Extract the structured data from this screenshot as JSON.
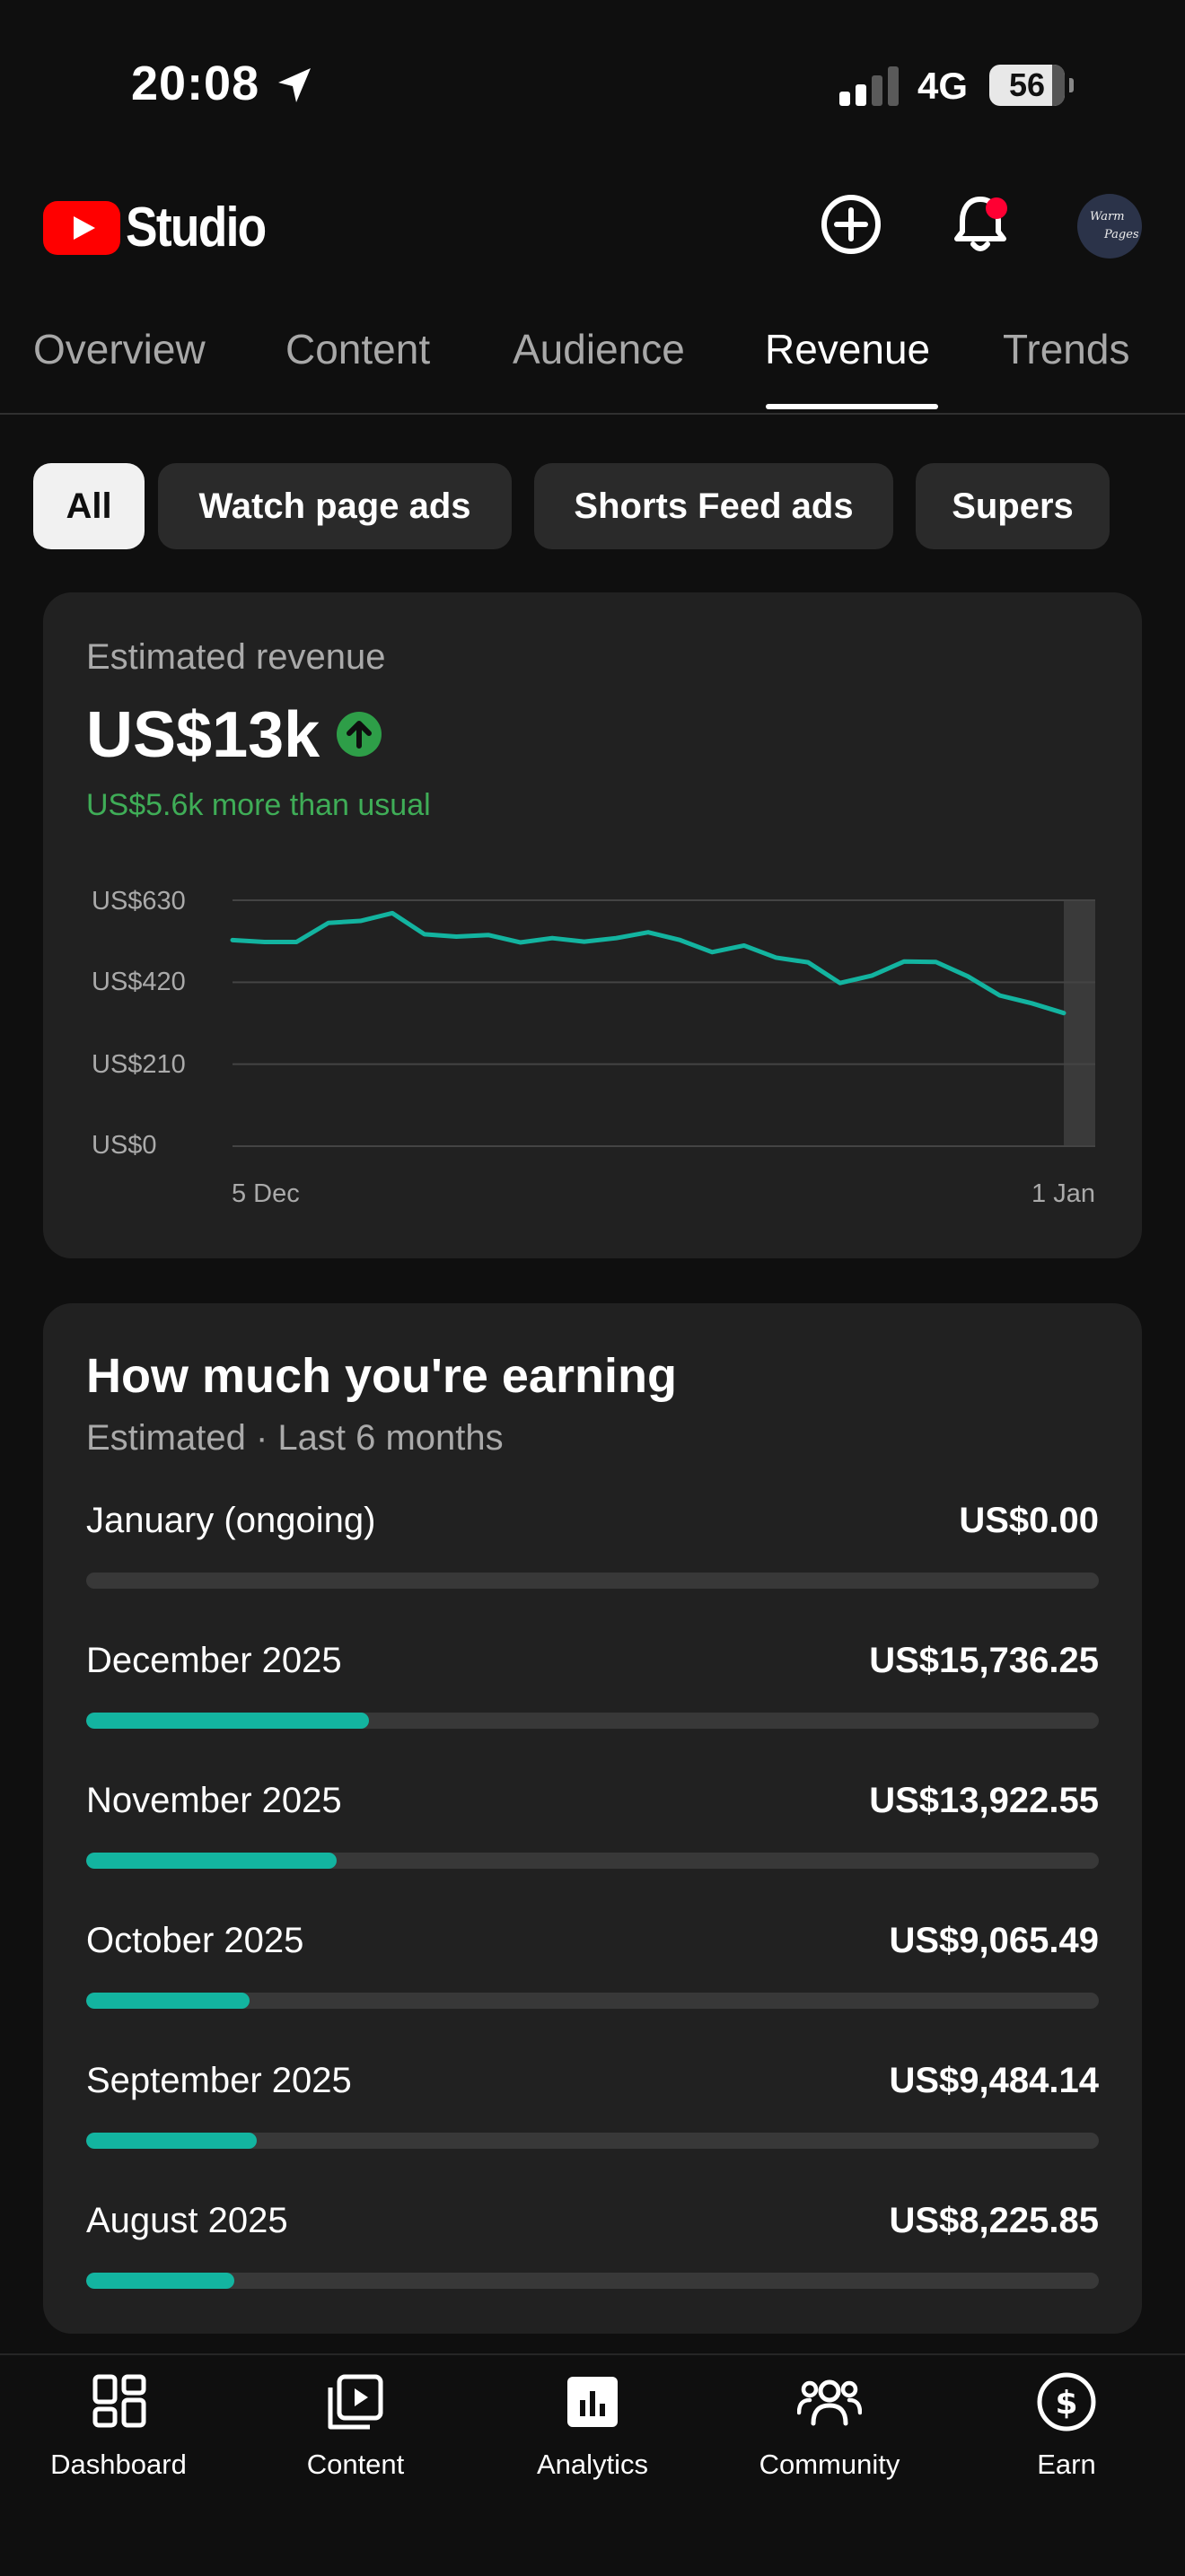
{
  "status_bar": {
    "time": "20:08",
    "network": "4G",
    "battery": "56"
  },
  "header": {
    "app_name": "Studio",
    "avatar_text": [
      "Warm",
      "Pages"
    ]
  },
  "tabs": [
    {
      "label": "Overview",
      "active": false
    },
    {
      "label": "Content",
      "active": false
    },
    {
      "label": "Audience",
      "active": false
    },
    {
      "label": "Revenue",
      "active": true
    },
    {
      "label": "Trends",
      "active": false
    }
  ],
  "chips": [
    {
      "label": "All",
      "active": true
    },
    {
      "label": "Watch page ads",
      "active": false
    },
    {
      "label": "Shorts Feed ads",
      "active": false
    },
    {
      "label": "Supers",
      "active": false
    }
  ],
  "revenue_card": {
    "label": "Estimated revenue",
    "value": "US$13k",
    "comparison": "US$5.6k more than usual",
    "accent": "#13b4a0",
    "positive_color": "#3fad57"
  },
  "chart_data": {
    "type": "line",
    "x_start_label": "5 Dec",
    "x_end_label": "1 Jan",
    "y_tick_labels": [
      "US$630",
      "US$420",
      "US$210",
      "US$0"
    ],
    "y_ticks": [
      630,
      420,
      210,
      0
    ],
    "ylim": [
      0,
      630
    ],
    "grid": true,
    "values": [
      528,
      523,
      523,
      572,
      577,
      597,
      543,
      537,
      541,
      522,
      533,
      524,
      533,
      548,
      528,
      497,
      514,
      483,
      471,
      418,
      437,
      473,
      472,
      435,
      386,
      366,
      341
    ]
  },
  "earnings": {
    "title": "How much you're earning",
    "subtitle": "Estimated · Last 6 months",
    "rows": [
      {
        "name": "January (ongoing)",
        "value": "US$0.00",
        "progress": 0.0
      },
      {
        "name": "December 2025",
        "value": "US$15,736.25",
        "progress": 0.279
      },
      {
        "name": "November 2025",
        "value": "US$13,922.55",
        "progress": 0.247
      },
      {
        "name": "October 2025",
        "value": "US$9,065.49",
        "progress": 0.161
      },
      {
        "name": "September 2025",
        "value": "US$9,484.14",
        "progress": 0.168
      },
      {
        "name": "August 2025",
        "value": "US$8,225.85",
        "progress": 0.146
      }
    ]
  },
  "bottom_nav": [
    {
      "label": "Dashboard",
      "icon": "dashboard-icon"
    },
    {
      "label": "Content",
      "icon": "content-icon"
    },
    {
      "label": "Analytics",
      "icon": "analytics-icon"
    },
    {
      "label": "Community",
      "icon": "community-icon"
    },
    {
      "label": "Earn",
      "icon": "earn-icon"
    }
  ]
}
